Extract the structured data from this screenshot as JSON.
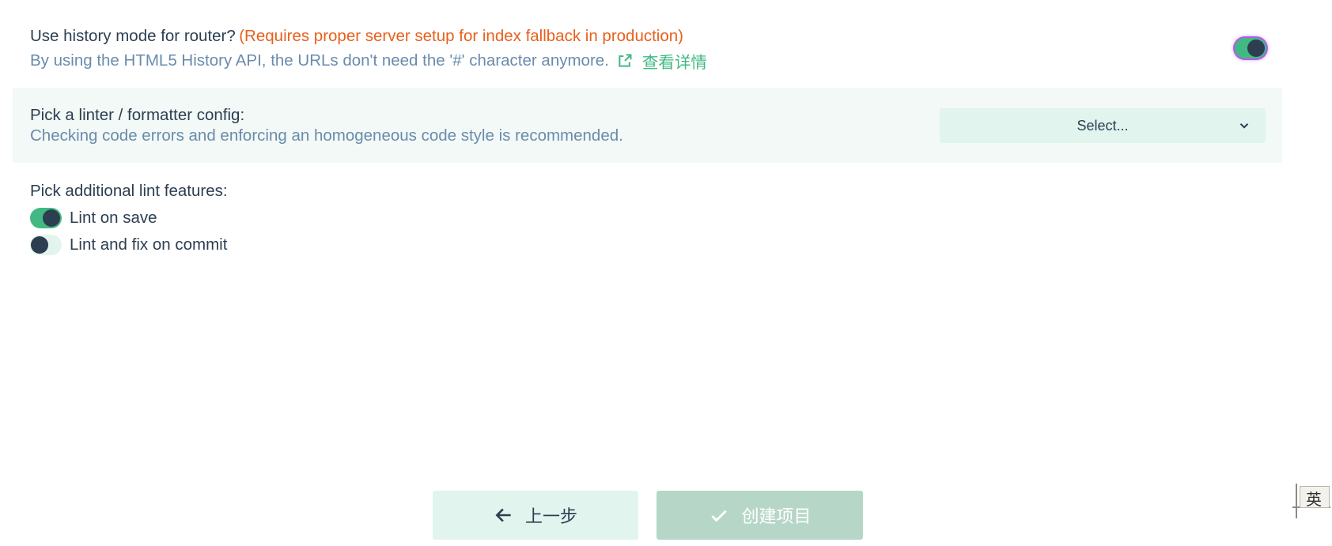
{
  "router": {
    "title": "Use history mode for router?",
    "warning": "(Requires proper server setup for index fallback in production)",
    "description": "By using the HTML5 History API, the URLs don't need the '#' character anymore.",
    "link_label": "查看详情",
    "enabled": true
  },
  "linter": {
    "title": "Pick a linter / formatter config:",
    "description": "Checking code errors and enforcing an homogeneous code style is recommended.",
    "select_placeholder": "Select..."
  },
  "lint_features": {
    "title": "Pick additional lint features:",
    "options": [
      {
        "label": "Lint on save",
        "enabled": true
      },
      {
        "label": "Lint and fix on commit",
        "enabled": false
      }
    ]
  },
  "footer": {
    "back_label": "上一步",
    "create_label": "创建项目"
  },
  "ime": {
    "label": "英"
  },
  "colors": {
    "accent": "#42b983",
    "warning": "#e8601c",
    "text": "#2c3e50",
    "muted": "#6a8bad",
    "panel": "#f2f9f6",
    "control_bg": "#e2f4ee",
    "create_bg": "#b6d7c8"
  }
}
